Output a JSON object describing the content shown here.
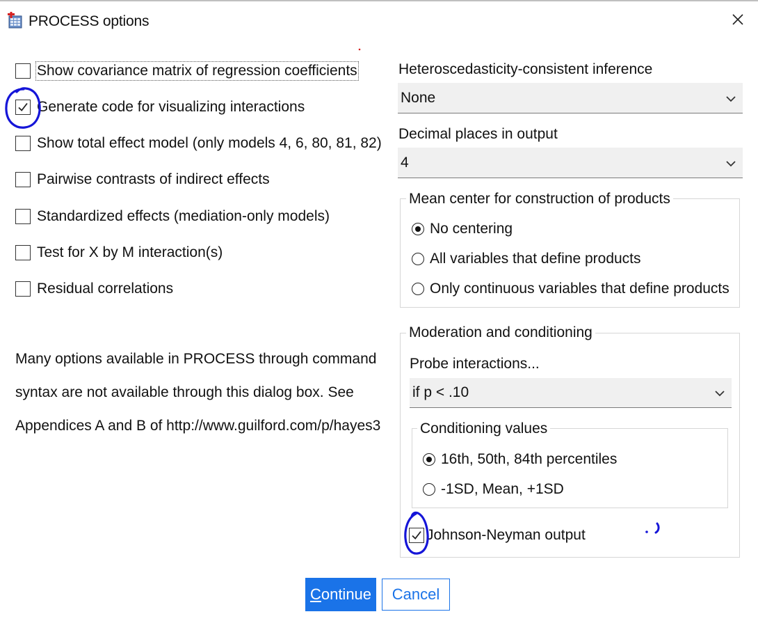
{
  "window": {
    "title": "PROCESS options",
    "icon": "spss-app-icon",
    "close_icon": "close-icon"
  },
  "left_options": [
    {
      "label": "Show covariance matrix of regression coefficients",
      "checked": false,
      "focused": true
    },
    {
      "label": "Generate code for visualizing interactions",
      "checked": true
    },
    {
      "label": "Show total effect model (only models 4, 6, 80, 81, 82)",
      "checked": false
    },
    {
      "label": "Pairwise contrasts of indirect effects",
      "checked": false
    },
    {
      "label": "Standardized effects (mediation-only models)",
      "checked": false
    },
    {
      "label": "Test for X by M interaction(s)",
      "checked": false
    },
    {
      "label": "Residual correlations",
      "checked": false
    }
  ],
  "note": {
    "lines": [
      "Many options available in PROCESS through command",
      "syntax are not available through this dialog box.  See",
      "Appendices A and B of http://www.guilford.com/p/hayes3"
    ]
  },
  "hc_inference": {
    "label": "Heteroscedasticity-consistent inference",
    "value": "None"
  },
  "decimal_places": {
    "label": "Decimal places in output",
    "value": "4"
  },
  "mean_center": {
    "legend": "Mean center for construction of products",
    "options": [
      {
        "label": "No centering",
        "selected": true
      },
      {
        "label": "All variables that define products",
        "selected": false
      },
      {
        "label": "Only continuous variables that define products",
        "selected": false
      }
    ]
  },
  "moderation": {
    "legend": "Moderation and conditioning",
    "probe_label": "Probe interactions...",
    "probe_value": "if p < .10",
    "conditioning": {
      "legend": "Conditioning values",
      "options": [
        {
          "label": "16th, 50th, 84th percentiles",
          "selected": true
        },
        {
          "label": "-1SD, Mean, +1SD",
          "selected": false
        }
      ]
    },
    "jn": {
      "label": "Johnson-Neyman output",
      "checked": true
    }
  },
  "buttons": {
    "continue_first": "C",
    "continue_rest": "ontinue",
    "cancel": "Cancel"
  },
  "colors": {
    "accent": "#1a73e8",
    "annotation_ink": "#1515d8",
    "select_bg": "#f0f0f0",
    "group_border": "#d6d6d6"
  }
}
